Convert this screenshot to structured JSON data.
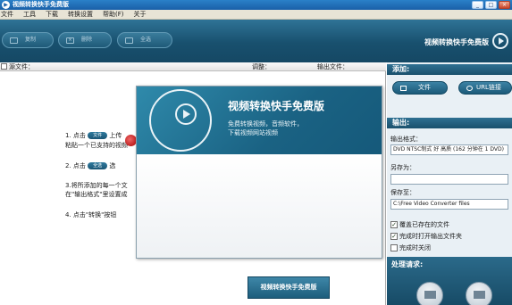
{
  "window": {
    "title": "视频转换快手免费版",
    "minimize": "_",
    "maximize": "□",
    "close": "×"
  },
  "menu": [
    "文件",
    "工具",
    "下载",
    "转换设置",
    "帮助(F)",
    "关于"
  ],
  "toolbar": {
    "copy_label": "复制",
    "delete_label": "删除",
    "select_all_label": "全选",
    "brand": "视频转换快手免费版"
  },
  "list": {
    "headers": {
      "source": "源文件：",
      "adjust": "调整：",
      "output_format": "输出文件："
    },
    "steps": [
      {
        "pre": "1. 点击",
        "pill": "文件",
        "post": "上传"
      },
      {
        "pre": "粘贴一个已支持的视频",
        "pill": "",
        "post": ""
      },
      {
        "pre": "2. 点击",
        "pill": "全选",
        "post": "选"
      },
      {
        "pre": "3.将所添加的每一个文",
        "pill": "",
        "post": ""
      },
      {
        "pre": "在\"输出格式\"里设置成",
        "pill": "",
        "post": ""
      },
      {
        "pre": "4. 点击\"转换\"按钮",
        "pill": "",
        "post": ""
      }
    ],
    "convert_label": "视频转换快手免费版"
  },
  "panel": {
    "add_title": "添加:",
    "file_button": "文件",
    "url_button": "URL链接",
    "output_title": "输出:",
    "format_label": "输出格式：",
    "format_value": "DVD NTSC制式 好 高质 (162 分钟在 1 DVD)",
    "save_as_label": "另存为：",
    "save_as_value": "",
    "save_to_label": "保存至：",
    "save_to_value": "C:\\Free Video Converter files",
    "checks": [
      {
        "label": "覆盖已存在的文件",
        "checked": "✓"
      },
      {
        "label": "完成时打开输出文件夹",
        "checked": "✓"
      },
      {
        "label": "完成时关闭",
        "checked": ""
      }
    ],
    "process_title": "处理请求:"
  },
  "splash": {
    "title": "视频转换快手免费版",
    "line1": "免费转换视频，音频软件，",
    "line2": "下载视频网站视频"
  }
}
